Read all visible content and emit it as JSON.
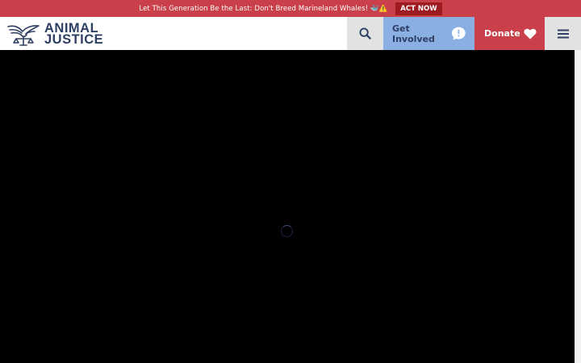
{
  "banner": {
    "message": "Let This Generation Be the Last: Don't Breed Marineland Whales! 🐳⚠️",
    "cta_label": "ACT NOW",
    "background": "#c9404a",
    "cta_background": "#9e1b22"
  },
  "logo": {
    "line1": "ANIMAL",
    "line2": "JUSTICE",
    "icon": "dove-scales-icon",
    "color": "#2f3e63"
  },
  "nav": {
    "search_icon": "search-icon",
    "get_involved_label": "Get Involved",
    "get_involved_icon": "exclamation-speech-bubble-icon",
    "get_involved_bg": "#8ab0e3",
    "donate_label": "Donate",
    "donate_icon": "heart-icon",
    "donate_bg": "#c9404a",
    "menu_icon": "hamburger-menu-icon"
  },
  "main": {
    "video_state": "loading",
    "background": "#000000"
  }
}
